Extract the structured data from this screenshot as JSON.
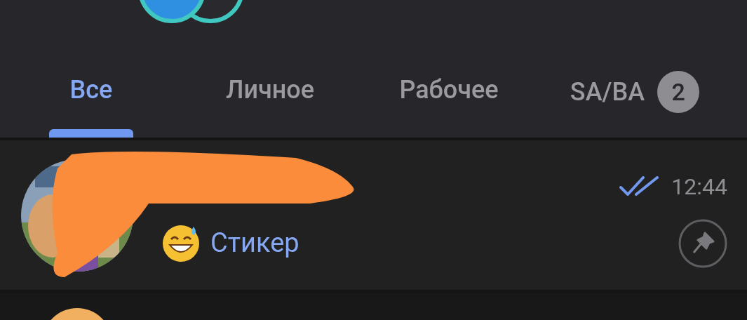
{
  "tabs": [
    {
      "label": "Все",
      "selected": true
    },
    {
      "label": "Личное",
      "selected": false
    },
    {
      "label": "Рабочее",
      "selected": false
    },
    {
      "label": "SA/BA",
      "selected": false,
      "badge": "2"
    }
  ],
  "chats": [
    {
      "preview": "Стикер",
      "time": "12:44",
      "read": true,
      "pinned": true
    }
  ]
}
